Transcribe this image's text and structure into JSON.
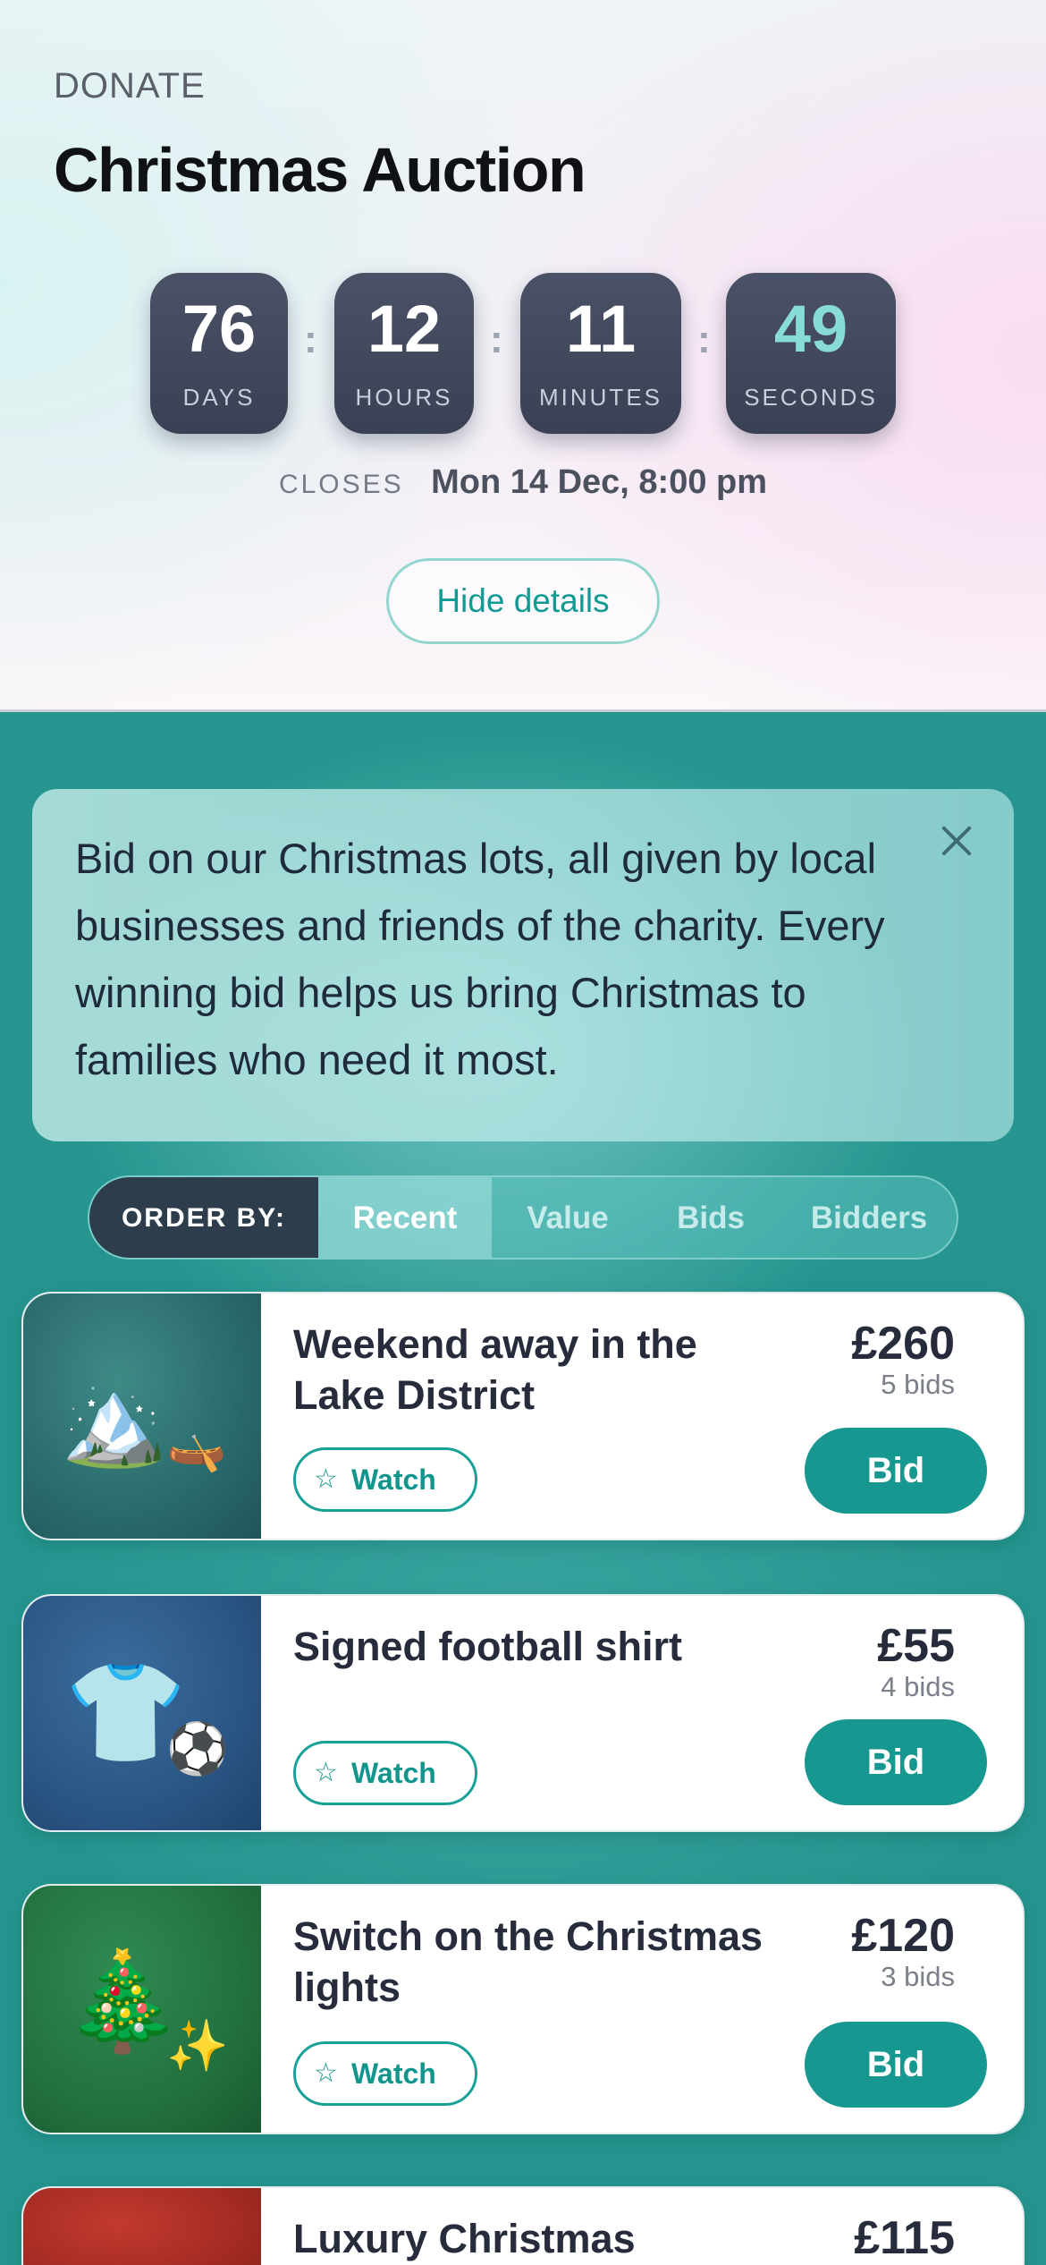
{
  "header": {
    "eyebrow": "DONATE",
    "title": "Christmas Auction",
    "countdown": [
      {
        "value": "76",
        "label": "DAYS"
      },
      {
        "value": "12",
        "label": "HOURS"
      },
      {
        "value": "11",
        "label": "MINUTES"
      },
      {
        "value": "49",
        "label": "SECONDS"
      }
    ],
    "separator": ":",
    "closes_label": "CLOSES",
    "closes_value": "Mon 14 Dec, 8:00 pm",
    "hide_button": "Hide details"
  },
  "intro": {
    "text": "Bid on our Christmas lots, all given by local businesses and friends of the charity. Every winning bid helps us bring Christmas to families who need it most.",
    "close_icon": "close-icon"
  },
  "order_by": {
    "label": "ORDER BY:",
    "options": [
      "Recent",
      "Value",
      "Bids",
      "Bidders"
    ],
    "active": "Recent"
  },
  "lots": [
    {
      "title": "Weekend away in the Lake District",
      "price": "£260",
      "bids": "5 bids",
      "watch": "Watch",
      "bid": "Bid",
      "emoji": [
        "🏔️",
        "🛶"
      ]
    },
    {
      "title": "Signed football shirt",
      "price": "£55",
      "bids": "4 bids",
      "watch": "Watch",
      "bid": "Bid",
      "emoji": [
        "👕",
        "⚽"
      ]
    },
    {
      "title": "Switch on the Christmas lights",
      "price": "£120",
      "bids": "3 bids",
      "watch": "Watch",
      "bid": "Bid",
      "emoji": [
        "🎄",
        "✨"
      ]
    },
    {
      "title": "Luxury Christmas",
      "price": "£115"
    }
  ],
  "colors": {
    "teal_accent": "#169790",
    "countdown_bg": "#454b5f",
    "seconds_accent": "#88dcd6",
    "order_label_bg": "#2e3d4b"
  }
}
